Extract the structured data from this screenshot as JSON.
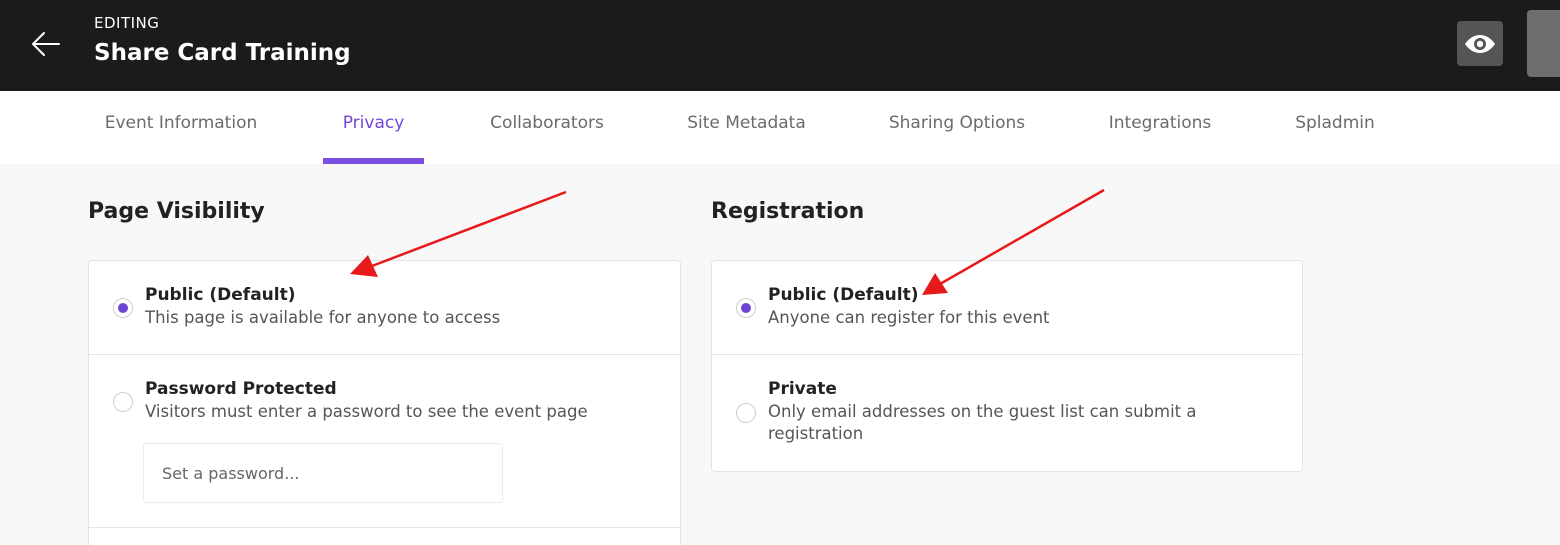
{
  "header": {
    "editing_label": "EDITING",
    "title": "Share Card Training"
  },
  "icons": {
    "back": "arrow-left-icon",
    "preview": "eye-icon"
  },
  "tabs": [
    {
      "label": "Event Information",
      "active": false
    },
    {
      "label": "Privacy",
      "active": true
    },
    {
      "label": "Collaborators",
      "active": false
    },
    {
      "label": "Site Metadata",
      "active": false
    },
    {
      "label": "Sharing Options",
      "active": false
    },
    {
      "label": "Integrations",
      "active": false
    },
    {
      "label": "Spladmin",
      "active": false
    }
  ],
  "page_visibility": {
    "title": "Page Visibility",
    "options": [
      {
        "title": "Public (Default)",
        "description": "This page is available for anyone to access",
        "selected": true
      },
      {
        "title": "Password Protected",
        "description": "Visitors must enter a password to see the event page",
        "selected": false
      }
    ],
    "password_placeholder": "Set a password..."
  },
  "registration": {
    "title": "Registration",
    "options": [
      {
        "title": "Public (Default)",
        "description": "Anyone can register for this event",
        "selected": true
      },
      {
        "title": "Private",
        "description": "Only email addresses on the guest list can submit a registration",
        "selected": false
      }
    ]
  },
  "colors": {
    "accent": "#7346d8",
    "annotation_arrow": "#e8191a",
    "header_bg": "#1b1b1b"
  }
}
